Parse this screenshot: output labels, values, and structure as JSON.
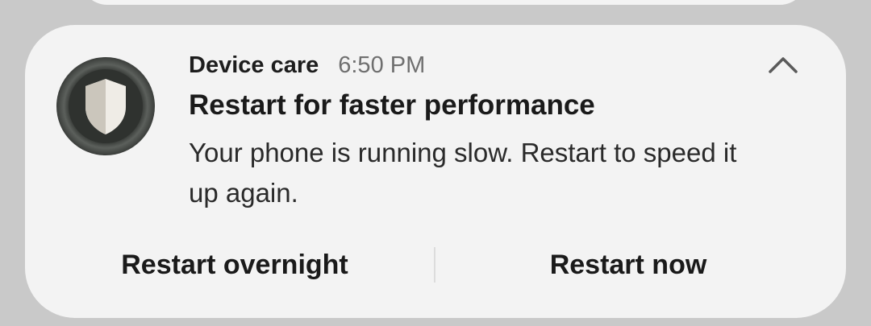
{
  "notification": {
    "app_name": "Device care",
    "time": "6:50 PM",
    "app_icon": "shield-icon",
    "collapse_icon": "chevron-up-icon",
    "title": "Restart for faster performance",
    "body": "Your phone is running slow. Restart to speed it up again.",
    "actions": [
      {
        "label": "Restart overnight"
      },
      {
        "label": "Restart now"
      }
    ]
  },
  "colors": {
    "background": "#c9c9c9",
    "card": "#f3f3f3",
    "icon_ring": "#2f322f",
    "shield_light": "#efece6",
    "shield_shade": "#cbc6bc"
  }
}
